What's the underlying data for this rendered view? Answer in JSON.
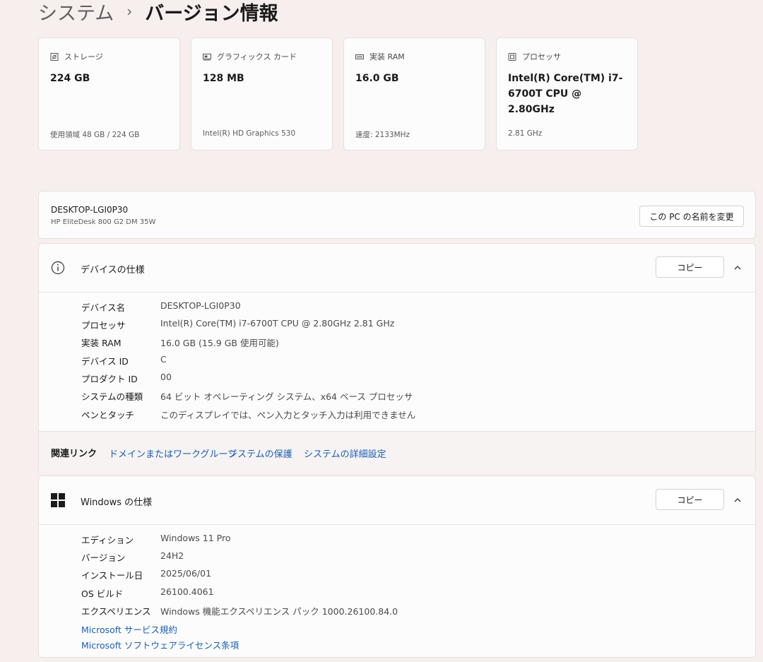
{
  "breadcrumb": {
    "parent": "システム",
    "separator": "›",
    "current": "バージョン情報"
  },
  "tiles": [
    {
      "label": "ストレージ",
      "value": "224 GB",
      "sub": "使用領域 48 GB / 224 GB",
      "icon": "storage-icon"
    },
    {
      "label": "グラフィックス カード",
      "value": "128 MB",
      "sub": "Intel(R) HD Graphics 530",
      "icon": "graphics-card-icon"
    },
    {
      "label": "実装 RAM",
      "value": "16.0 GB",
      "sub": "速度: 2133MHz",
      "icon": "ram-icon"
    },
    {
      "label": "プロセッサ",
      "value": "Intel(R) Core(TM) i7-6700T CPU @ 2.80GHz",
      "sub": "2.81 GHz",
      "icon": "processor-icon"
    }
  ],
  "pc": {
    "name": "DESKTOP-LGI0P30",
    "model": "HP EliteDesk 800 G2 DM 35W",
    "rename_label": "この PC の名前を変更"
  },
  "device_spec": {
    "title": "デバイスの仕様",
    "copy_label": "コピー",
    "rows": [
      {
        "k": "デバイス名",
        "v": "DESKTOP-LGI0P30"
      },
      {
        "k": "プロセッサ",
        "v": "Intel(R) Core(TM) i7-6700T CPU @ 2.80GHz   2.81 GHz"
      },
      {
        "k": "実装 RAM",
        "v": "16.0 GB (15.9 GB 使用可能)"
      },
      {
        "k": "デバイス ID",
        "v": "C"
      },
      {
        "k": "プロダクト ID",
        "v": "00"
      },
      {
        "k": "システムの種類",
        "v": "64 ビット オペレーティング システム、x64 ベース プロセッサ"
      },
      {
        "k": "ペンとタッチ",
        "v": "このディスプレイでは、ペン入力とタッチ入力は利用できません"
      }
    ]
  },
  "related": {
    "label": "関連リンク",
    "links": [
      "ドメインまたはワークグループ",
      "システムの保護",
      "システムの詳細設定"
    ]
  },
  "windows_spec": {
    "title": "Windows の仕様",
    "copy_label": "コピー",
    "rows": [
      {
        "k": "エディション",
        "v": "Windows 11 Pro"
      },
      {
        "k": "バージョン",
        "v": "24H2"
      },
      {
        "k": "インストール日",
        "v": "2025/06/01"
      },
      {
        "k": "OS ビルド",
        "v": "26100.4061"
      },
      {
        "k": "エクスペリエンス",
        "v": "Windows 機能エクスペリエンス パック 1000.26100.84.0"
      }
    ],
    "links": [
      "Microsoft サービス規約",
      "Microsoft ソフトウェアライセンス条項"
    ]
  },
  "colors": {
    "accent_link": "#1a5fb4",
    "background": "#f6efed",
    "card": "#fdfcfc"
  }
}
